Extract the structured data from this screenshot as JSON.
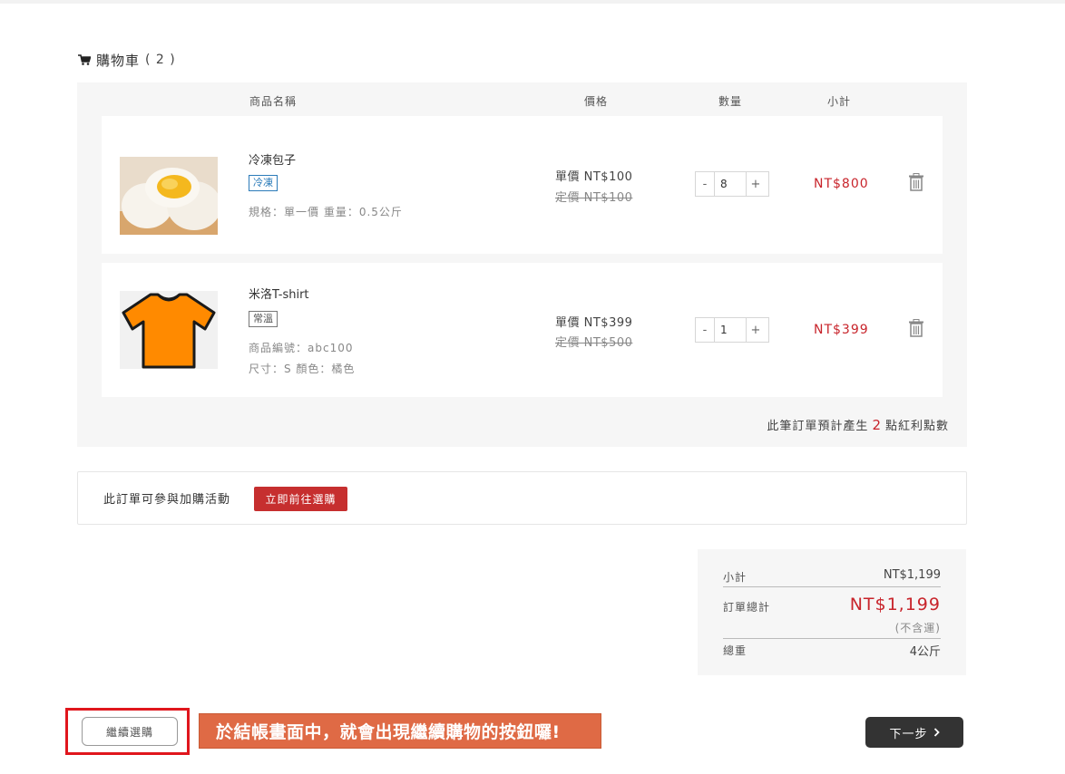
{
  "cart": {
    "title": "購物車",
    "count": "( 2 )"
  },
  "columns": {
    "name": "商品名稱",
    "price": "價格",
    "qty": "數量",
    "subtotal": "小計"
  },
  "items": [
    {
      "name": "冷凍包子",
      "tag": "冷凍",
      "spec1": "規格：單一價 重量：0.5公斤",
      "spec2": "",
      "unit_price": "單價 NT$100",
      "orig_price": "定價 NT$100",
      "qty": "8",
      "subtotal": "NT$800",
      "image_icon": "bun-image"
    },
    {
      "name": "米洛T-shirt",
      "tag": "常溫",
      "spec1": "商品編號：abc100",
      "spec2": "尺寸：S 顏色：橘色",
      "unit_price": "單價 NT$399",
      "orig_price": "定價 NT$500",
      "qty": "1",
      "subtotal": "NT$399",
      "image_icon": "tshirt-image"
    }
  ],
  "qty_controls": {
    "minus": "-",
    "plus": "+"
  },
  "points": {
    "prefix": "此筆訂單預計產生",
    "num": "2",
    "suffix": "點紅利點數"
  },
  "promo": {
    "text": "此訂單可參與加購活動",
    "button": "立即前往選購"
  },
  "summary": {
    "subtotal_label": "小計",
    "subtotal_value": "NT$1,199",
    "total_label": "訂單總計",
    "total_value": "NT$1,199",
    "tax_note": "(不含運)",
    "weight_label": "總重",
    "weight_value": "4公斤"
  },
  "footer": {
    "continue": "繼續選購",
    "callout": "於結帳畫面中，就會出現繼續購物的按鈕囉!",
    "next": "下一步"
  },
  "colors": {
    "accent_red": "#c8242b",
    "tag_blue": "#2b7bb9",
    "callout_bg": "#df6a45",
    "next_bg": "#333333"
  }
}
